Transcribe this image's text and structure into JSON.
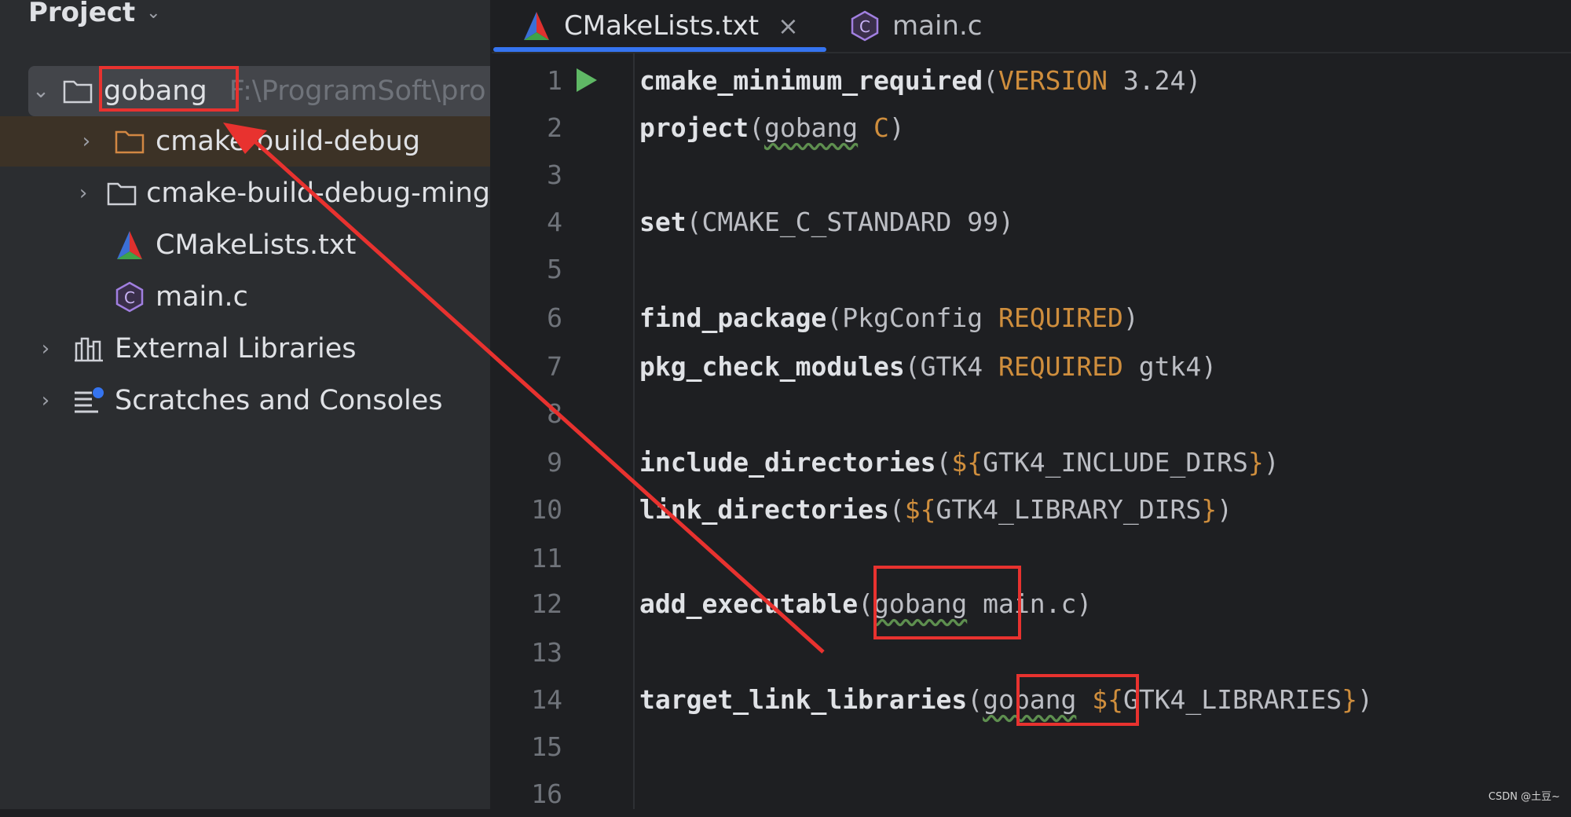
{
  "sidebar": {
    "title": "Project",
    "title_chevron": "⌄",
    "tree": {
      "root": {
        "label": "gobang",
        "path": "F:\\ProgramSoft\\pro"
      },
      "items": [
        {
          "label": "cmake-build-debug"
        },
        {
          "label": "cmake-build-debug-ming"
        },
        {
          "label": "CMakeLists.txt"
        },
        {
          "label": "main.c"
        },
        {
          "label": "External Libraries"
        },
        {
          "label": "Scratches and Consoles"
        }
      ]
    }
  },
  "tabs": [
    {
      "label": "CMakeLists.txt",
      "close": "×"
    },
    {
      "label": "main.c"
    }
  ],
  "editor": {
    "line_numbers": [
      "1",
      "2",
      "3",
      "4",
      "5",
      "6",
      "7",
      "8",
      "9",
      "10",
      "11",
      "12",
      "13",
      "14",
      "15",
      "16"
    ],
    "lines": {
      "l1": {
        "fn": "cmake_minimum_required",
        "p1": "(",
        "kw": "VERSION",
        "rest": " 3.24)"
      },
      "l2": {
        "fn": "project",
        "p1": "(",
        "name": "gobang",
        "sp": " ",
        "kw": "C",
        "rest": ")"
      },
      "l4": {
        "fn": "set",
        "rest": "(CMAKE_C_STANDARD 99)"
      },
      "l6": {
        "fn": "find_package",
        "p1": "(PkgConfig ",
        "kw": "REQUIRED",
        "rest": ")"
      },
      "l7": {
        "fn": "pkg_check_modules",
        "p1": "(GTK4 ",
        "kw": "REQUIRED",
        "rest": " gtk4)"
      },
      "l9": {
        "fn": "include_directories",
        "p1": "(",
        "open": "${",
        "var": "GTK4_INCLUDE_DIRS",
        "close": "}",
        "rest": ")"
      },
      "l10": {
        "fn": "link_directories",
        "p1": "(",
        "open": "${",
        "var": "GTK4_LIBRARY_DIRS",
        "close": "}",
        "rest": ")"
      },
      "l12": {
        "fn": "add_executable",
        "p1": "(",
        "name": "gobang",
        "rest": " main.c)"
      },
      "l14": {
        "fn": "target_link_libraries",
        "p1": "(",
        "name": "gobang",
        "sp": " ",
        "open": "${",
        "var": "GTK4_LIBRARIES",
        "close": "}",
        "rest": ")"
      }
    }
  },
  "watermark": "CSDN @土豆~",
  "colors": {
    "annotation_red": "#e8322f",
    "tab_active_underline": "#3574f0",
    "keyword_orange": "#cf8e3d",
    "run_green": "#5fb865"
  }
}
